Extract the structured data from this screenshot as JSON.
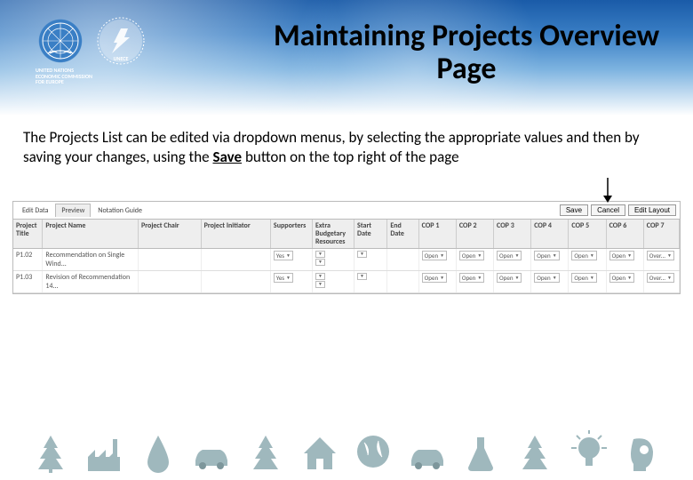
{
  "title": "Maintaining Projects Overview Page",
  "un_label": "UNITED NATIONS\nECONOMIC COMMISSION\nFOR EUROPE",
  "description_pre": "The Projects List can be edited via dropdown menus, by selecting the appropriate values and then by saving your changes, using the ",
  "description_save": "Save",
  "description_post": " button on the top right of the page",
  "tabs": {
    "edit": "Edit Data",
    "preview": "Preview",
    "notation": "Notation Guide"
  },
  "action_buttons": {
    "save": "Save",
    "cancel": "Cancel",
    "edit_layout": "Edit Layout"
  },
  "headers": {
    "title": "Project Title",
    "name": "Project Name",
    "chair": "Project Chair",
    "initiator": "Project Initiator",
    "supporters": "Supporters",
    "extra": "Extra Budgetary Resources",
    "sdate": "Start Date",
    "edate": "End Date",
    "cop1": "COP 1",
    "cop2": "COP 2",
    "cop3": "COP 3",
    "cop4": "COP 4",
    "cop5": "COP 5",
    "cop6": "COP 6",
    "cop7": "COP 7"
  },
  "rows": [
    {
      "title": "P1.02",
      "name": "Recommendation on Single Wind...",
      "supporters": "Yes",
      "cops": [
        "Open",
        "Open",
        "Open",
        "Open",
        "Open",
        "Open",
        "Over..."
      ]
    },
    {
      "title": "P1.03",
      "name": "Revision of Recommendation 14...",
      "supporters": "Yes",
      "cops": [
        "Open",
        "Open",
        "Open",
        "Open",
        "Open",
        "Open",
        "Over..."
      ]
    }
  ]
}
